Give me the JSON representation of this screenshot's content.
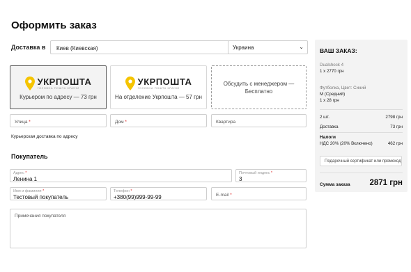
{
  "page": {
    "title": "Оформить заказ"
  },
  "delivery": {
    "label": "Доставка в",
    "city_value": "Киев (Киевская)",
    "region_value": "Украина"
  },
  "shipping_options": [
    {
      "brand": "УКРПОШТА",
      "brand_sub": "ГОЛОВНА ПОШТА КРАЇНИ",
      "caption": "Курьером по адресу — 73 грн",
      "selected": true
    },
    {
      "brand": "УКРПОШТА",
      "brand_sub": "ГОЛОВНА ПОШТА КРАЇНИ",
      "caption": "На отделение Укрпошта — 57 грн",
      "selected": false
    },
    {
      "text": "Обсудить с менеджером — Бесплатно",
      "selected": false
    }
  ],
  "address": {
    "street_placeholder": "Улица",
    "house_placeholder": "Дом",
    "apartment_placeholder": "Квартира",
    "courier_note": "Курьерская доставка по адресу"
  },
  "buyer": {
    "section_title": "Покупатель",
    "address_label": "Адрес",
    "address_value": "Ленина 1",
    "zip_label": "Почтовый индекс",
    "zip_value": "3",
    "name_label": "Имя и фамилия",
    "name_value": "Тестовый покупатель",
    "phone_label": "Телефон",
    "phone_value": "+380(99)999-99-99",
    "email_placeholder": "E-mail",
    "notes_placeholder": "Примечания покупателя"
  },
  "order": {
    "title": "ВАШ ЗАКАЗ:",
    "items": [
      {
        "name": "Dualshock 4",
        "qty": "1 x 2770 грн"
      },
      {
        "name": "Футболка, Цвет: Синий",
        "variant": "M (Средний)",
        "qty": "1 x 28 грн"
      }
    ],
    "count_label": "2 шт.",
    "count_value": "2798 грн",
    "delivery_label": "Доставка",
    "delivery_value": "73 грн",
    "tax_title": "Налоги",
    "vat_label": "НДС 20% (20% Включено)",
    "vat_value": "462 грн",
    "certificate_placeholder": "Подарочный сертификат или промокод",
    "total_label": "Сумма заказа",
    "total_value": "2871 грн"
  },
  "colors": {
    "accent_yellow": "#f5c400",
    "panel_bg": "#f3f3f3",
    "required_star": "#d22222"
  }
}
